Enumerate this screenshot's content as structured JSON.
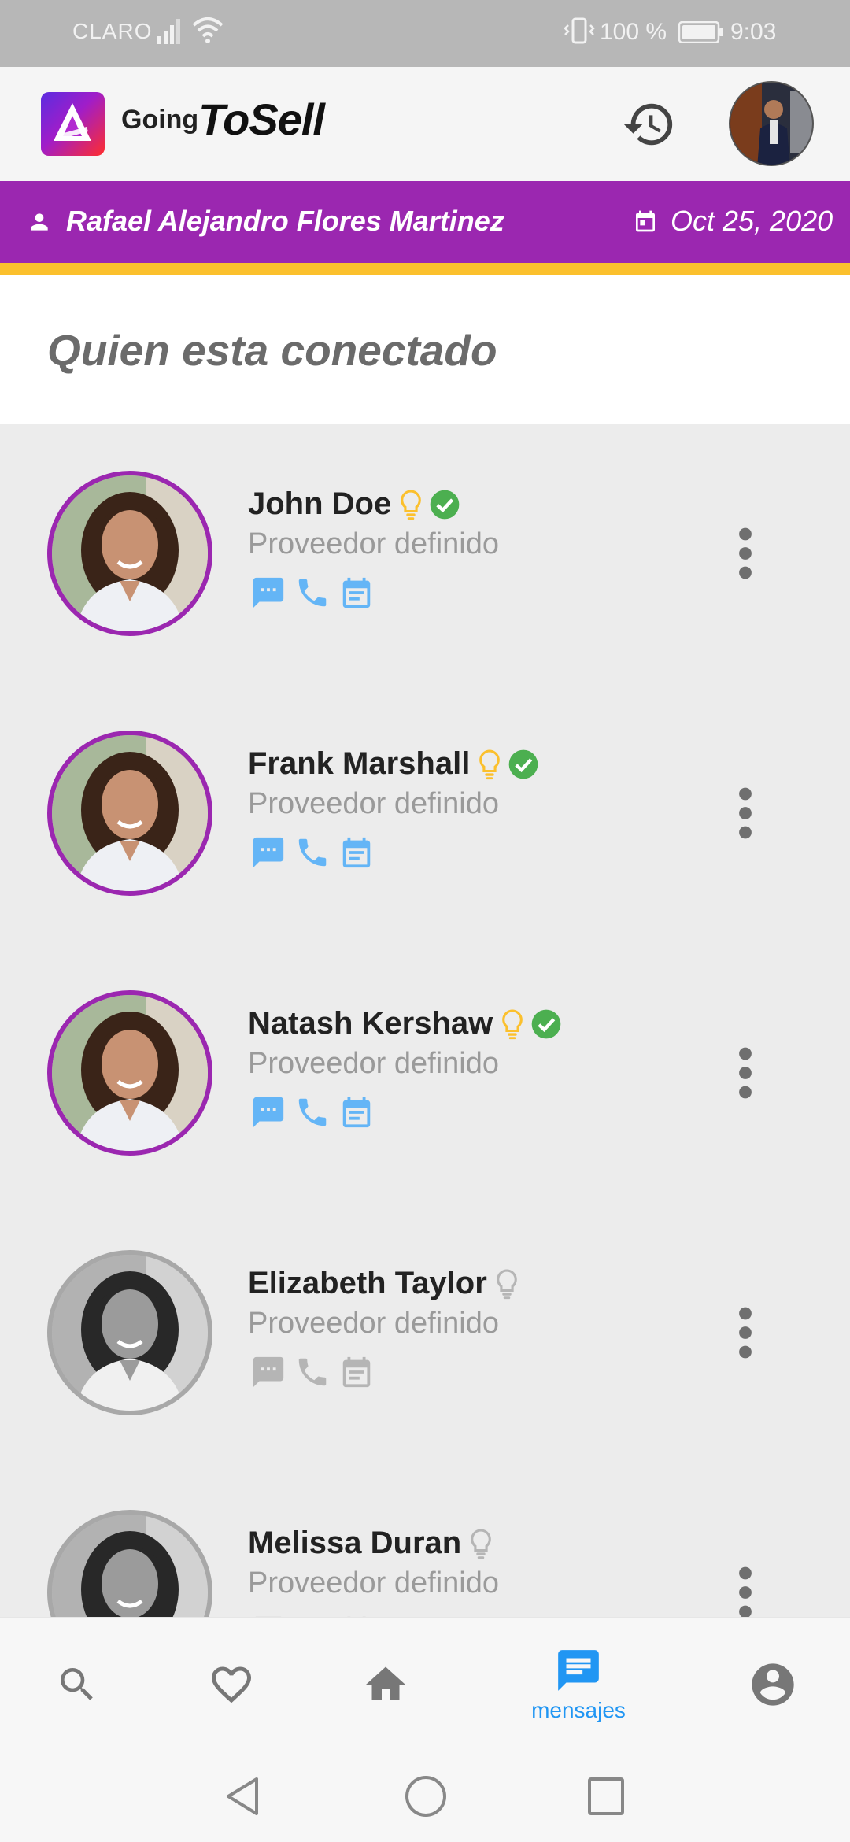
{
  "status_bar": {
    "carrier": "CLARO",
    "battery": "100 %",
    "time": "9:03"
  },
  "app": {
    "logo_going": "Going",
    "logo_tosell": "ToSell"
  },
  "user_bar": {
    "name": "Rafael Alejandro Flores Martinez",
    "date": "Oct 25, 2020"
  },
  "section": {
    "title": "Quien esta conectado"
  },
  "contacts": [
    {
      "name": "John Doe",
      "role": "Proveedor definido",
      "online": true,
      "verified": true
    },
    {
      "name": "Frank Marshall",
      "role": "Proveedor definido",
      "online": true,
      "verified": true
    },
    {
      "name": "Natash Kershaw",
      "role": "Proveedor definido",
      "online": true,
      "verified": true
    },
    {
      "name": "Elizabeth Taylor",
      "role": "Proveedor definido",
      "online": false,
      "verified": false
    },
    {
      "name": "Melissa Duran",
      "role": "Proveedor definido",
      "online": false,
      "verified": false
    }
  ],
  "bottom_nav": {
    "messages_label": "mensajes",
    "active": "messages"
  },
  "colors": {
    "purple": "#9b27b0",
    "yellow": "#fbc02d",
    "blue": "#2196f3",
    "light_blue": "#64b5f6",
    "green": "#4caf50"
  }
}
